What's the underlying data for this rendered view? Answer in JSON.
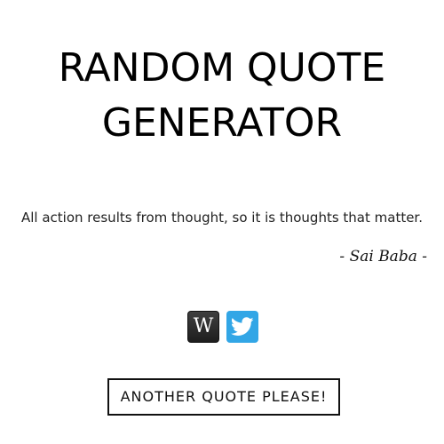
{
  "title": {
    "line1": "RANDOM QUOTE",
    "line2": "GENERATOR"
  },
  "quote": {
    "text": "All action results from thought, so it is thoughts that matter.",
    "author": "- Sai Baba -"
  },
  "share": {
    "wikipedia_glyph": "W",
    "wikipedia_icon": "wikipedia-icon",
    "twitter_icon": "twitter-bird-icon",
    "twitter_color": "#32a6e6",
    "wikipedia_color": "#2b2b2b"
  },
  "button": {
    "label": "ANOTHER QUOTE PLEASE!"
  }
}
